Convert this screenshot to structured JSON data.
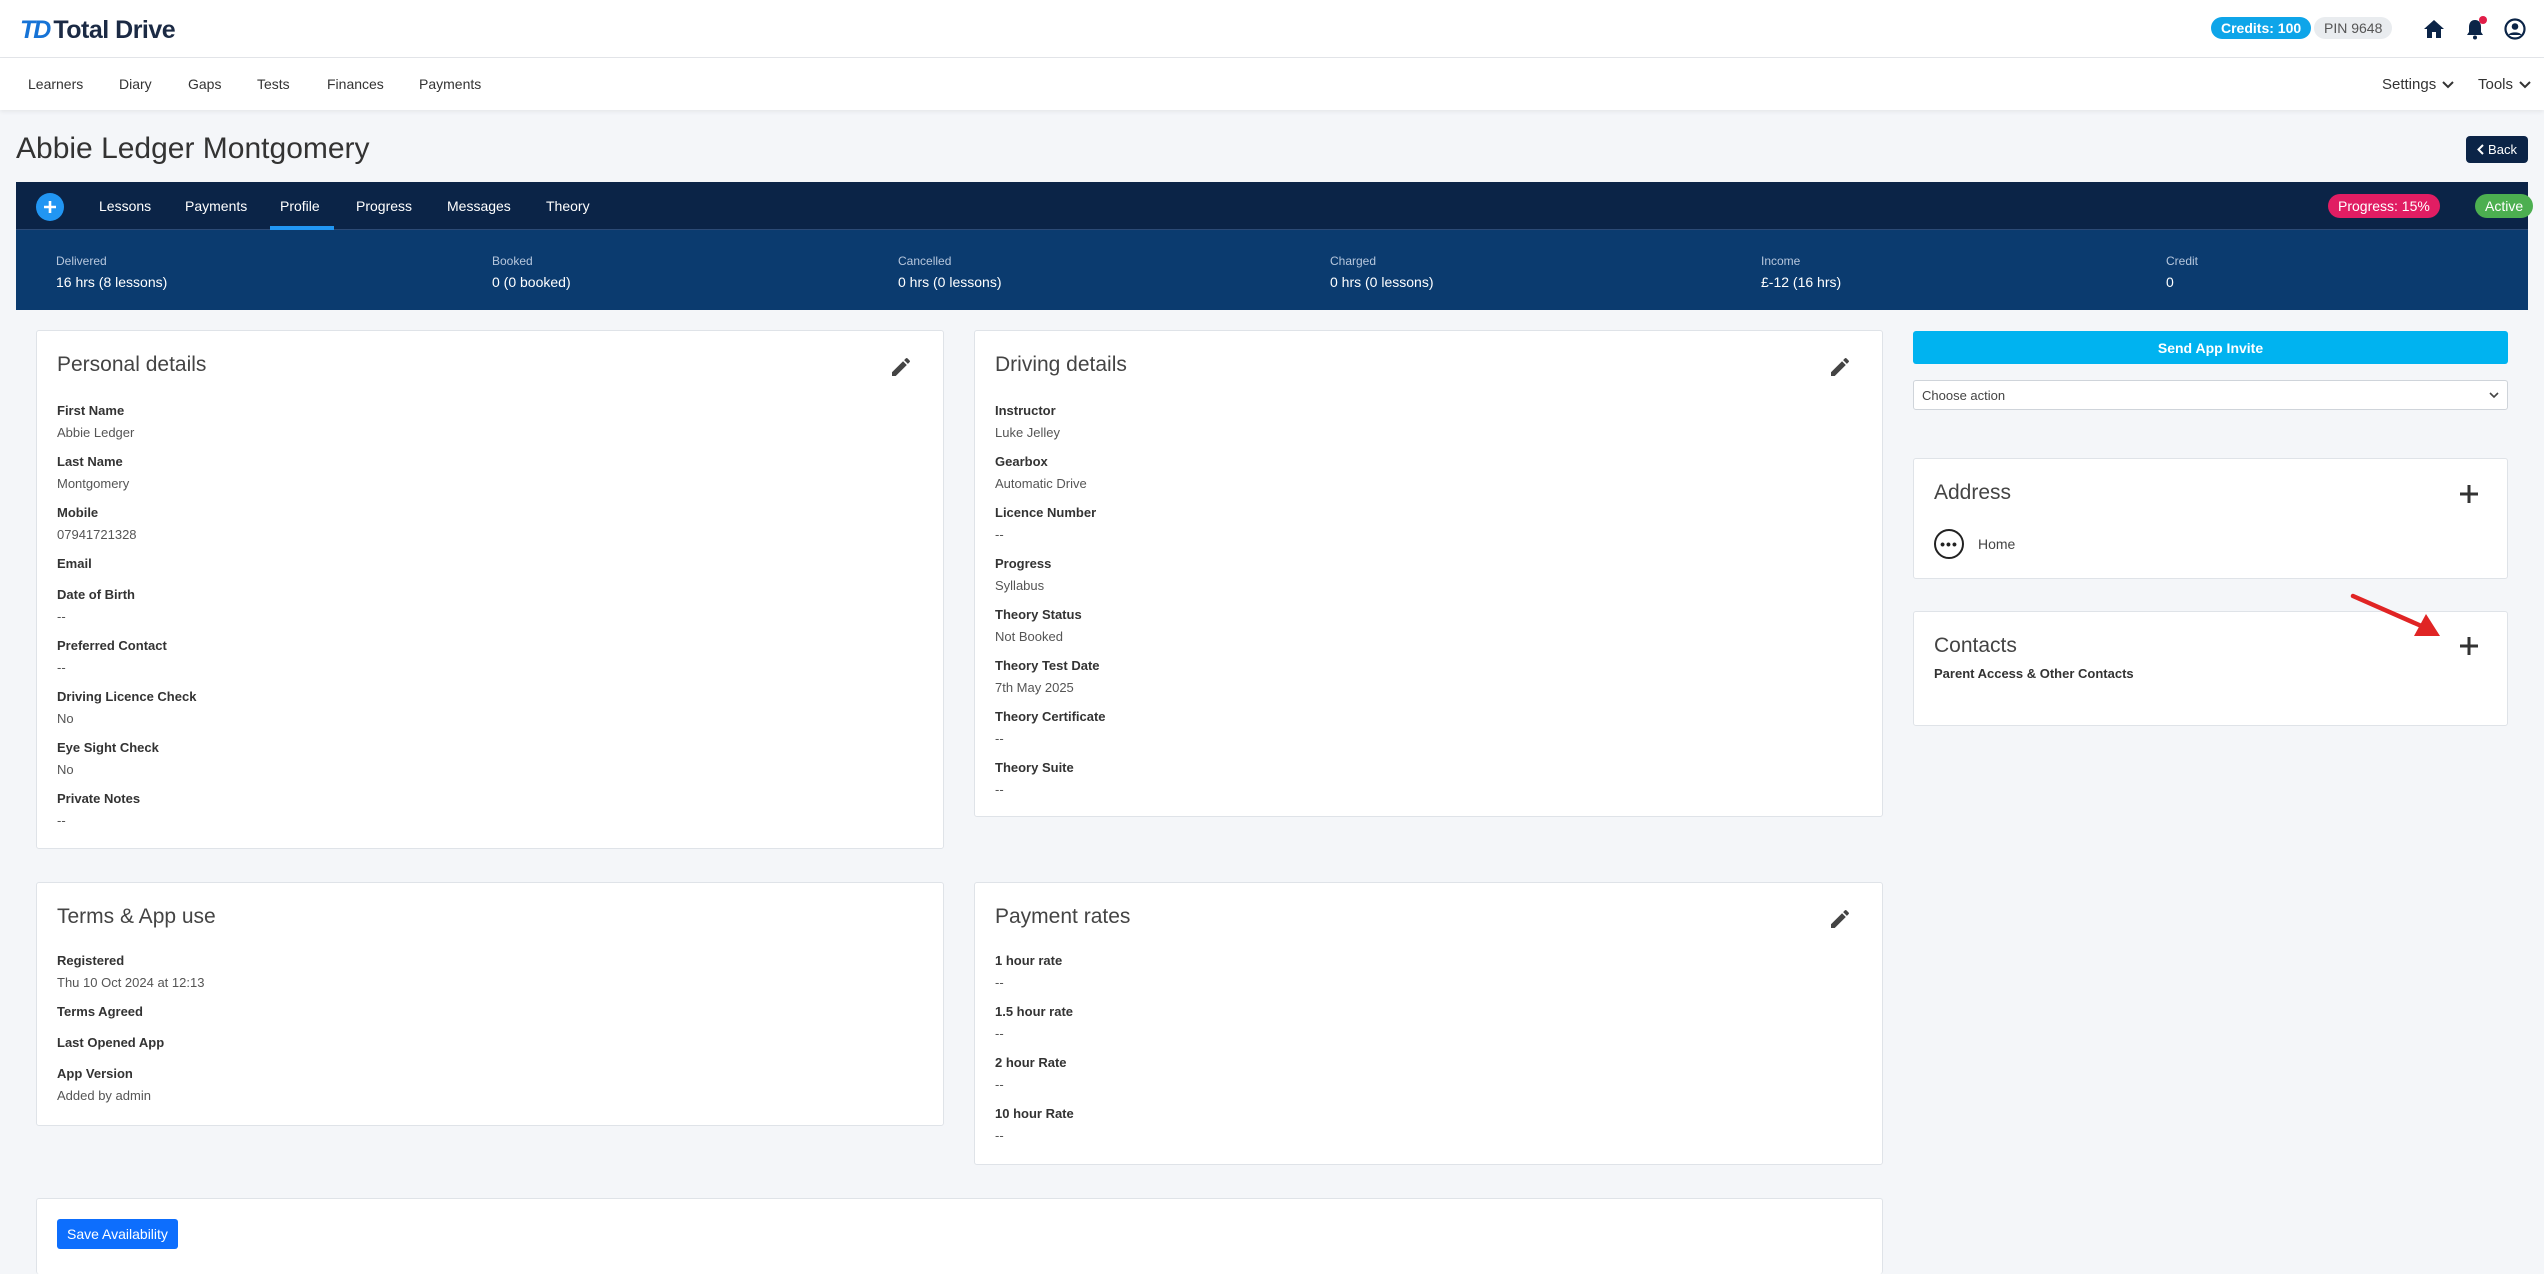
{
  "brand": {
    "mark": "TD",
    "name": "Total Drive"
  },
  "header": {
    "credits": "Credits: 100",
    "pin": "PIN 9648"
  },
  "nav": {
    "items": [
      "Learners",
      "Diary",
      "Gaps",
      "Tests",
      "Finances",
      "Payments"
    ],
    "settings": "Settings",
    "tools": "Tools"
  },
  "page": {
    "title": "Abbie Ledger Montgomery",
    "back_label": "Back"
  },
  "tabs": {
    "items": [
      "Lessons",
      "Payments",
      "Profile",
      "Progress",
      "Messages",
      "Theory"
    ],
    "active": "Profile",
    "progress_badge": "Progress: 15%",
    "status_badge": "Active"
  },
  "stats": [
    {
      "label": "Delivered",
      "value": "16 hrs (8 lessons)"
    },
    {
      "label": "Booked",
      "value": "0 (0 booked)"
    },
    {
      "label": "Cancelled",
      "value": "0 hrs (0 lessons)"
    },
    {
      "label": "Charged",
      "value": "0 hrs (0 lessons)"
    },
    {
      "label": "Income",
      "value": "£-12 (16 hrs)"
    },
    {
      "label": "Credit",
      "value": "0"
    }
  ],
  "personal": {
    "title": "Personal details",
    "fields": [
      {
        "label": "First Name",
        "value": "Abbie Ledger"
      },
      {
        "label": "Last Name",
        "value": "Montgomery"
      },
      {
        "label": "Mobile",
        "value": "07941721328"
      },
      {
        "label": "Email",
        "value": ""
      },
      {
        "label": "Date of Birth",
        "value": "--"
      },
      {
        "label": "Preferred Contact",
        "value": "--"
      },
      {
        "label": "Driving Licence Check",
        "value": "No"
      },
      {
        "label": "Eye Sight Check",
        "value": "No"
      },
      {
        "label": "Private Notes",
        "value": "--"
      }
    ]
  },
  "driving": {
    "title": "Driving details",
    "fields": [
      {
        "label": "Instructor",
        "value": "Luke Jelley"
      },
      {
        "label": "Gearbox",
        "value": "Automatic Drive"
      },
      {
        "label": "Licence Number",
        "value": "--"
      },
      {
        "label": "Progress",
        "value": "Syllabus"
      },
      {
        "label": "Theory Status",
        "value": "Not Booked"
      },
      {
        "label": "Theory Test Date",
        "value": "7th May 2025"
      },
      {
        "label": "Theory Certificate",
        "value": "--"
      },
      {
        "label": "Theory Suite",
        "value": "--"
      }
    ]
  },
  "terms": {
    "title": "Terms & App use",
    "fields": [
      {
        "label": "Registered",
        "value": "Thu 10 Oct 2024 at 12:13"
      },
      {
        "label": "Terms Agreed",
        "value": ""
      },
      {
        "label": "Last Opened App",
        "value": ""
      },
      {
        "label": "App Version",
        "value": "Added by admin"
      }
    ]
  },
  "rates": {
    "title": "Payment rates",
    "fields": [
      {
        "label": "1 hour rate",
        "value": "--"
      },
      {
        "label": "1.5 hour rate",
        "value": "--"
      },
      {
        "label": "2 hour Rate",
        "value": "--"
      },
      {
        "label": "10 hour Rate",
        "value": "--"
      }
    ]
  },
  "side": {
    "send_invite": "Send App Invite",
    "choose_action": "Choose action",
    "address_title": "Address",
    "address_home": "Home",
    "dots": "•••",
    "contacts_title": "Contacts",
    "contacts_sub": "Parent Access & Other Contacts"
  },
  "availability": {
    "save_label": "Save Availability"
  },
  "colors": {
    "navy": "#0b2447",
    "stats_bg": "#0b3b6f",
    "accent_blue": "#2196f3",
    "invite_blue": "#00b3f0",
    "progress_pink": "#e11d63",
    "active_green": "#4caf50",
    "annotation_arrow": "#e02424"
  }
}
